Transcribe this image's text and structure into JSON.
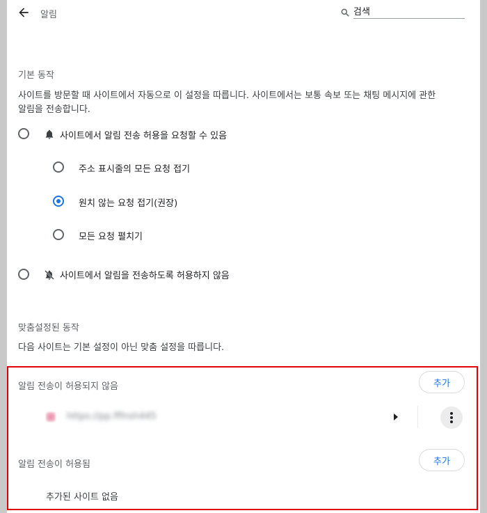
{
  "header": {
    "title": "알림",
    "search_placeholder": "검색"
  },
  "default_behavior": {
    "heading": "기본 동작",
    "description_line1": "사이트를 방문할 때 사이트에서 자동으로 이 설정을 따릅니다. 사이트에서는 보통 속보 또는 채팅 메시지에 관한",
    "description_line2": "알림을 전송합니다.",
    "options": {
      "allow_label": "사이트에서 알림 전송 허용을 요청할 수 있음",
      "sub_options": [
        {
          "label": "주소 표시줄의 모든 요청 접기",
          "selected": false
        },
        {
          "label": "원치 않는 요청 접기(권장)",
          "selected": true
        },
        {
          "label": "모든 요청 펼치기",
          "selected": false
        }
      ],
      "block_label": "사이트에서 알림을 전송하도록 허용하지 않음"
    }
  },
  "custom_behavior": {
    "heading": "맞춤설정된 동작",
    "description": "다음 사이트는 기본 설정이 아닌 맞춤 설정을 따릅니다."
  },
  "blocked_section": {
    "heading": "알림 전송이 허용되지 않음",
    "add_label": "추가",
    "site": {
      "url": "https://pp.fffnsh445"
    }
  },
  "allowed_section": {
    "heading": "알림 전송이 허용됨",
    "add_label": "추가",
    "empty_text": "추가된 사이트 없음"
  },
  "colors": {
    "accent": "#1a73e8",
    "highlight_border": "#e00000"
  }
}
